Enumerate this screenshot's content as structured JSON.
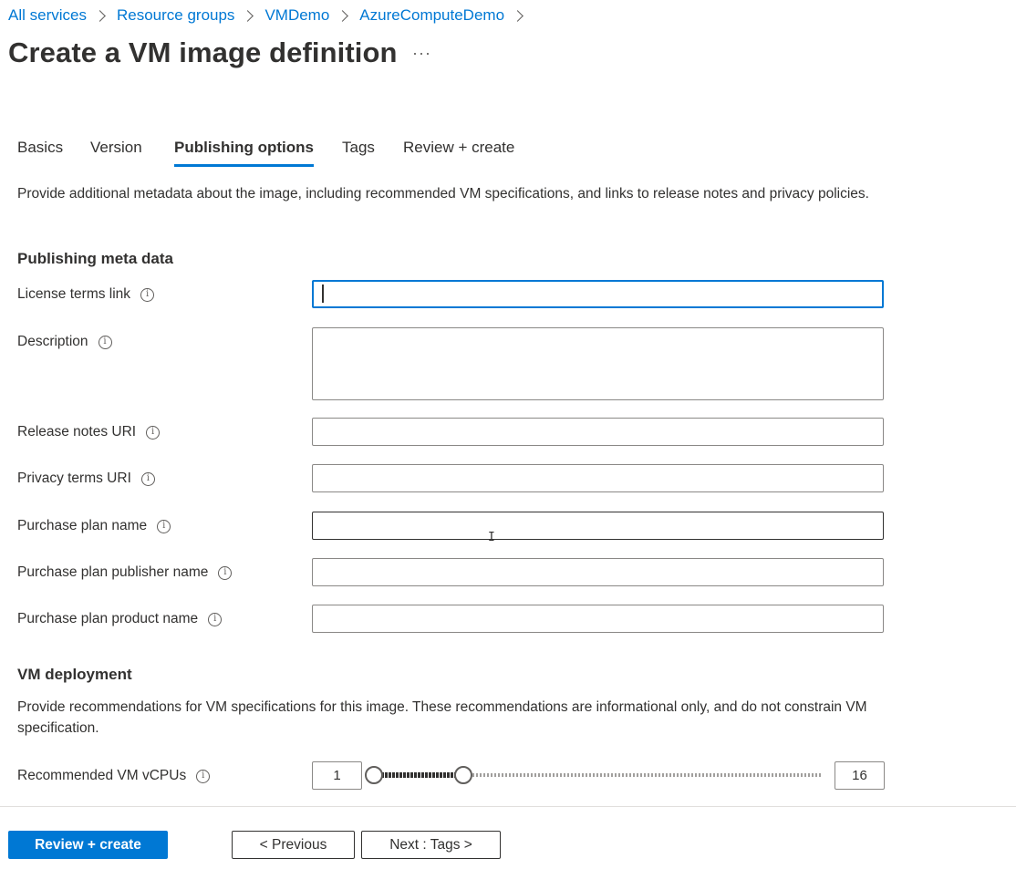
{
  "breadcrumb": [
    "All services",
    "Resource groups",
    "VMDemo",
    "AzureComputeDemo"
  ],
  "title": "Create a VM image definition",
  "more_label": "···",
  "tabs": [
    {
      "label": "Basics"
    },
    {
      "label": "Version"
    },
    {
      "label": "Publishing options",
      "active": true
    },
    {
      "label": "Tags"
    },
    {
      "label": "Review + create"
    }
  ],
  "intro": "Provide additional metadata about the image, including recommended VM specifications, and links to release notes and privacy policies.",
  "publishing": {
    "heading": "Publishing meta data",
    "fields": [
      {
        "label": "License terms link",
        "value": ""
      },
      {
        "label": "Description",
        "value": ""
      },
      {
        "label": "Release notes URI",
        "value": ""
      },
      {
        "label": "Privacy terms URI",
        "value": ""
      },
      {
        "label": "Purchase plan name",
        "value": ""
      },
      {
        "label": "Purchase plan publisher name",
        "value": ""
      },
      {
        "label": "Purchase plan product name",
        "value": ""
      }
    ]
  },
  "vm_deployment": {
    "heading": "VM deployment",
    "desc": "Provide recommendations for VM specifications for this image. These recommendations are informational only, and do not constrain VM specification.",
    "vcpus": {
      "label": "Recommended VM vCPUs",
      "min": "1",
      "max": "16",
      "range_low": 1,
      "range_high": 4,
      "scale_min": 1,
      "scale_max": 16
    }
  },
  "info_glyph": "i",
  "footer": {
    "review_create": "Review + create",
    "previous": "< Previous",
    "next": "Next : Tags >"
  },
  "colors": {
    "accent": "#0078d4",
    "text": "#323130"
  }
}
